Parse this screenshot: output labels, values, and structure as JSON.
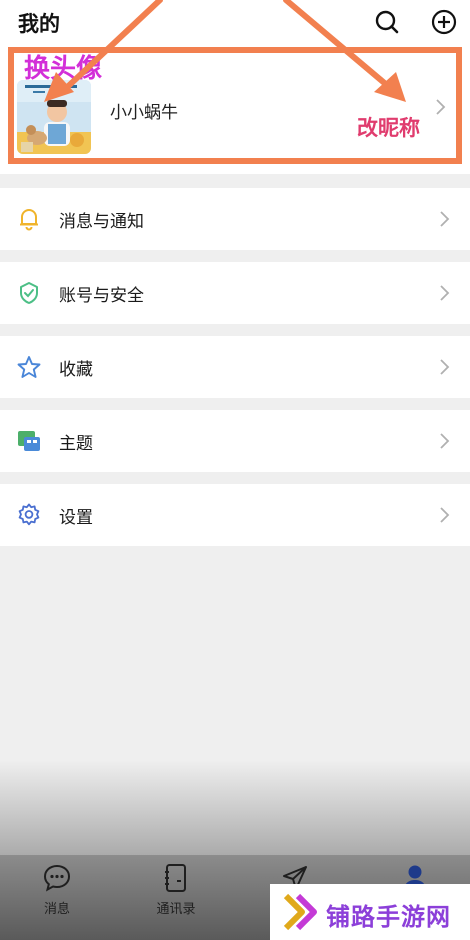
{
  "header": {
    "title": "我的"
  },
  "profile": {
    "nickname": "小小蜗牛"
  },
  "menu": [
    {
      "label": "消息与通知",
      "icon": "bell-icon"
    },
    {
      "label": "账号与安全",
      "icon": "shield-icon"
    },
    {
      "label": "收藏",
      "icon": "star-icon"
    },
    {
      "label": "主题",
      "icon": "theme-icon"
    },
    {
      "label": "设置",
      "icon": "gear-icon"
    }
  ],
  "tabs": [
    {
      "label": "消息",
      "icon": "chat-bubble-icon"
    },
    {
      "label": "通讯录",
      "icon": "contacts-icon"
    },
    {
      "label": "",
      "icon": "send-icon"
    },
    {
      "label": "",
      "icon": "person-icon",
      "active": true
    }
  ],
  "annotations": {
    "avatar_hint": "换头像",
    "nickname_hint": "改昵称"
  },
  "watermark": {
    "text": "铺路手游网"
  },
  "colors": {
    "annotation_box": "#f2804f",
    "annotation_avatar_text": "#d32fd8",
    "annotation_nick_text": "#e03c6e",
    "active_tab": "#1e3a8a",
    "watermark_text": "#8c3fd9"
  }
}
